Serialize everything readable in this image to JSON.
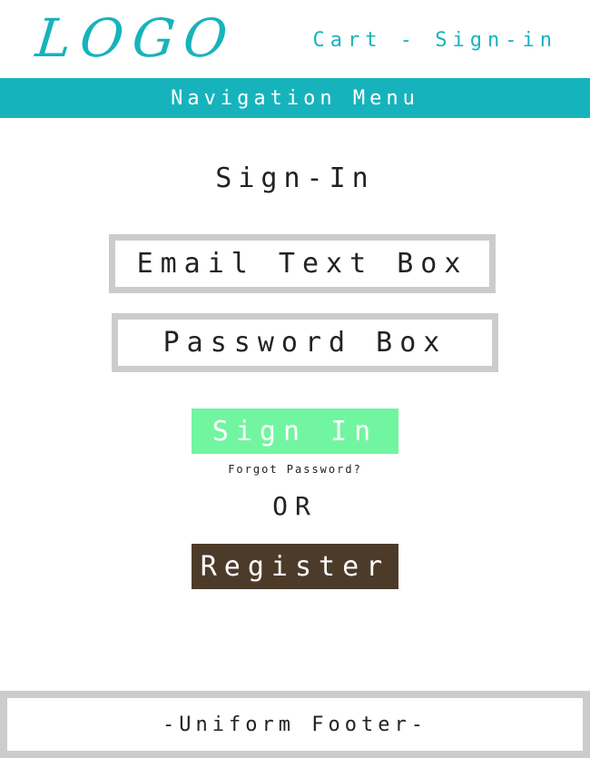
{
  "header": {
    "logo": "LOGO",
    "cart_link": "Cart",
    "separator": " - ",
    "signin_link": "Sign-in"
  },
  "nav": {
    "label": "Navigation Menu"
  },
  "main": {
    "title": "Sign-In",
    "email_box": "Email Text Box",
    "password_box": "Password Box",
    "signin_button": "Sign In",
    "forgot_link": "Forgot Password?",
    "or_text": "OR",
    "register_button": "Register"
  },
  "footer": {
    "label": "-Uniform Footer-"
  },
  "colors": {
    "accent": "#17b3bc",
    "signin_button": "#72f5a0",
    "register_button": "#4d3b2a",
    "border_gray": "#cccccc"
  }
}
